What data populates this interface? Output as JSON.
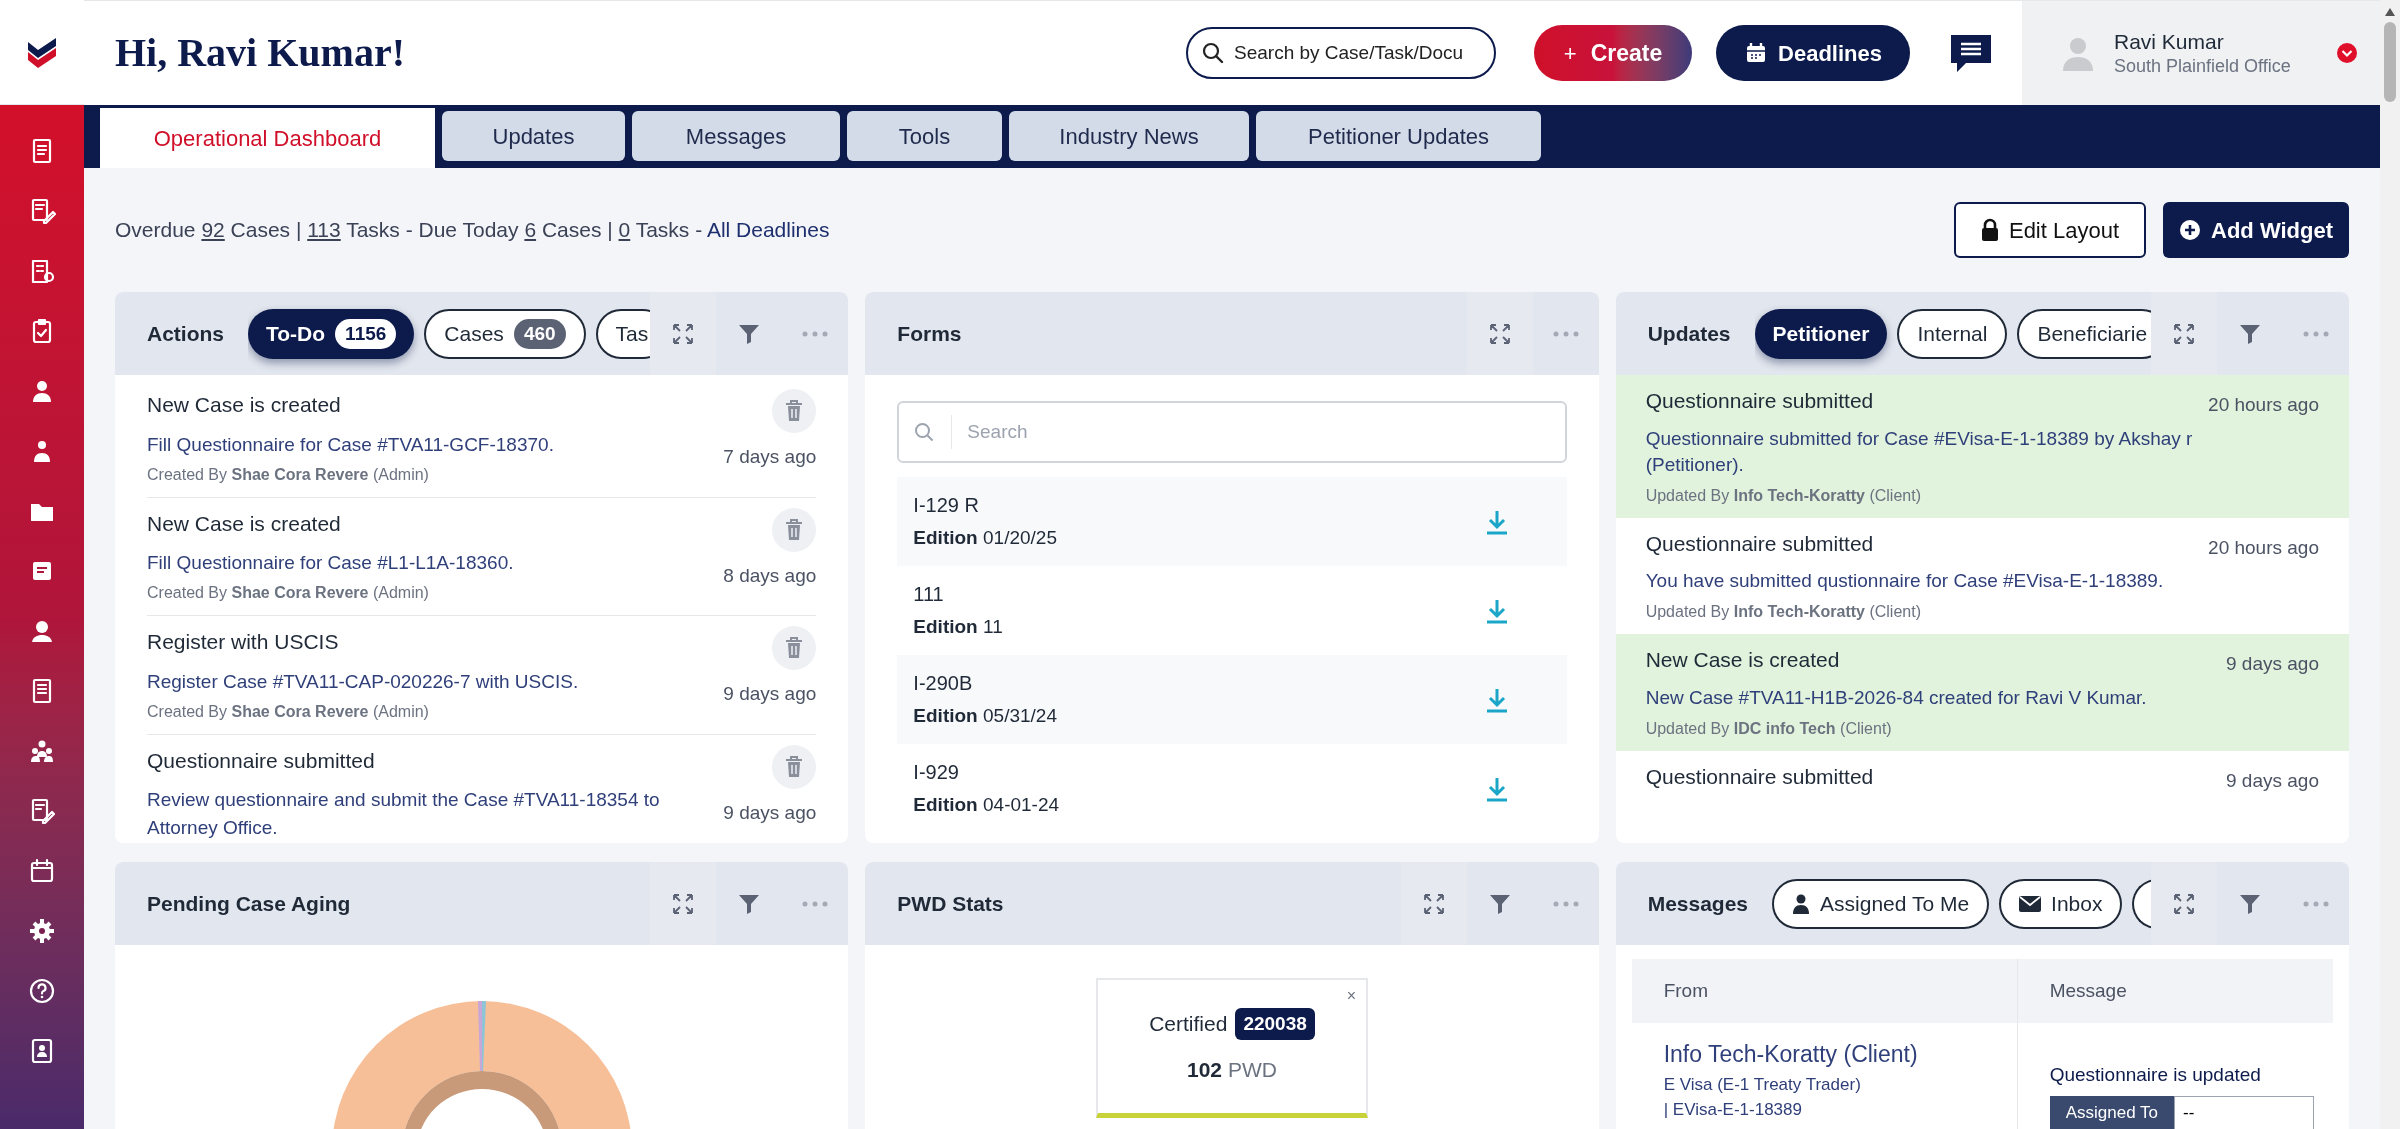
{
  "header": {
    "greeting": "Hi, Ravi Kumar!",
    "search": {
      "placeholder": "Search by Case/Task/Docu"
    },
    "create_button": {
      "icon": "+",
      "label": "Create"
    },
    "deadlines_button": "Deadlines",
    "user": {
      "name": "Ravi Kumar",
      "office": "South Plainfield Office"
    }
  },
  "tabs": [
    {
      "label": "Operational Dashboard",
      "selected": true
    },
    {
      "label": "Updates",
      "selected": false
    },
    {
      "label": "Messages",
      "selected": false
    },
    {
      "label": "Tools",
      "selected": false
    },
    {
      "label": "Industry News",
      "selected": false
    },
    {
      "label": "Petitioner Updates",
      "selected": false
    }
  ],
  "summary": [
    {
      "kind": "text",
      "text": "Overdue "
    },
    {
      "kind": "count",
      "text": "92"
    },
    {
      "kind": "text",
      "text": " Cases | "
    },
    {
      "kind": "count",
      "text": "113"
    },
    {
      "kind": "text",
      "text": " Tasks - Due Today "
    },
    {
      "kind": "count",
      "text": "6"
    },
    {
      "kind": "text",
      "text": " Cases | "
    },
    {
      "kind": "count",
      "text": "0"
    },
    {
      "kind": "text",
      "text": " Tasks - "
    },
    {
      "kind": "link",
      "text": "All Deadlines"
    }
  ],
  "toolbar": {
    "edit_layout": "Edit Layout",
    "add_widget": "Add Widget"
  },
  "actions": {
    "title": "Actions",
    "filterable": true,
    "filters": [
      {
        "label": "To-Do",
        "count": "1156",
        "selected": true
      },
      {
        "label": "Cases",
        "count": "460",
        "selected": false
      },
      {
        "label": "Tas",
        "selected": false
      }
    ],
    "items": [
      {
        "title": "New Case is created",
        "description": "Fill Questionnaire for Case #TVA11-GCF-18370.",
        "created_by": "Created By **Shae Cora Revere** (Admin)",
        "time": "7 days ago"
      },
      {
        "title": "New Case is created",
        "description": "Fill Questionnaire for Case #L1-L1A-18360.",
        "created_by": "Created By **Shae Cora Revere** (Admin)",
        "time": "8 days ago"
      },
      {
        "title": "Register with USCIS",
        "description": "Register Case #TVA11-CAP-020226-7 with USCIS.",
        "created_by": "Created By **Shae Cora Revere** (Admin)",
        "time": "9 days ago"
      },
      {
        "title": "Questionnaire submitted",
        "description": "Review questionnaire and submit the Case #TVA11-18354 to Attorney Office.",
        "time": "9 days ago"
      }
    ]
  },
  "forms": {
    "title": "Forms",
    "filterable": false,
    "search": {
      "placeholder": "Search"
    },
    "items": [
      {
        "name": "I-129 R",
        "edition": "**Edition** 01/20/25"
      },
      {
        "name": "111",
        "edition": "**Edition** 11"
      },
      {
        "name": "I-290B",
        "edition": "**Edition** 05/31/24"
      },
      {
        "name": "I-929",
        "edition": "**Edition** 04-01-24"
      }
    ]
  },
  "updates": {
    "title": "Updates",
    "filterable": true,
    "filters": [
      {
        "label": "Petitioner",
        "selected": true
      },
      {
        "label": "Internal",
        "selected": false
      },
      {
        "label": "Beneficiarie",
        "selected": false
      }
    ],
    "items": [
      {
        "title": "Questionnaire submitted",
        "time": "20 hours ago",
        "highlighted": true,
        "description": "Questionnaire submitted for Case #EVisa-E-1-18389 by Akshay r (Petitioner).",
        "updated_by": "Updated By **Info Tech-Koratty** (Client)"
      },
      {
        "title": "Questionnaire submitted",
        "time": "20 hours ago",
        "highlighted": false,
        "description": "You have submitted qustionnaire for Case #EVisa-E-1-18389.",
        "updated_by": "Updated By **Info Tech-Koratty** (Client)"
      },
      {
        "title": "New Case is created",
        "time": "9 days ago",
        "highlighted": true,
        "description": "New Case #TVA11-H1B-2026-84 created for Ravi V Kumar.",
        "updated_by": "Updated By **IDC info Tech** (Client)"
      },
      {
        "title": "Questionnaire submitted",
        "time": "9 days ago",
        "highlighted": false
      }
    ]
  },
  "pending_case_aging": {
    "title": "Pending Case Aging",
    "filterable": true
  },
  "pwd_stats": {
    "title": "PWD Stats",
    "filterable": true,
    "card": {
      "label": "Certified",
      "count": "220038",
      "value": "102",
      "unit": "PWD",
      "close": "×"
    }
  },
  "messages": {
    "title": "Messages",
    "filterable": true,
    "filters": [
      {
        "label": "Assigned To Me",
        "selected": false
      },
      {
        "label": "Inbox",
        "selected": false
      }
    ],
    "columns": [
      "From",
      "Message"
    ],
    "rows": [
      {
        "from": "Info Tech-Koratty (Client)",
        "details": [
          "E Visa (E-1 Treaty Trader)",
          "| EVisa-E-1-18389"
        ],
        "message": "Questionnaire is updated",
        "assign_label": "Assigned To",
        "assign_value": "--"
      }
    ]
  }
}
